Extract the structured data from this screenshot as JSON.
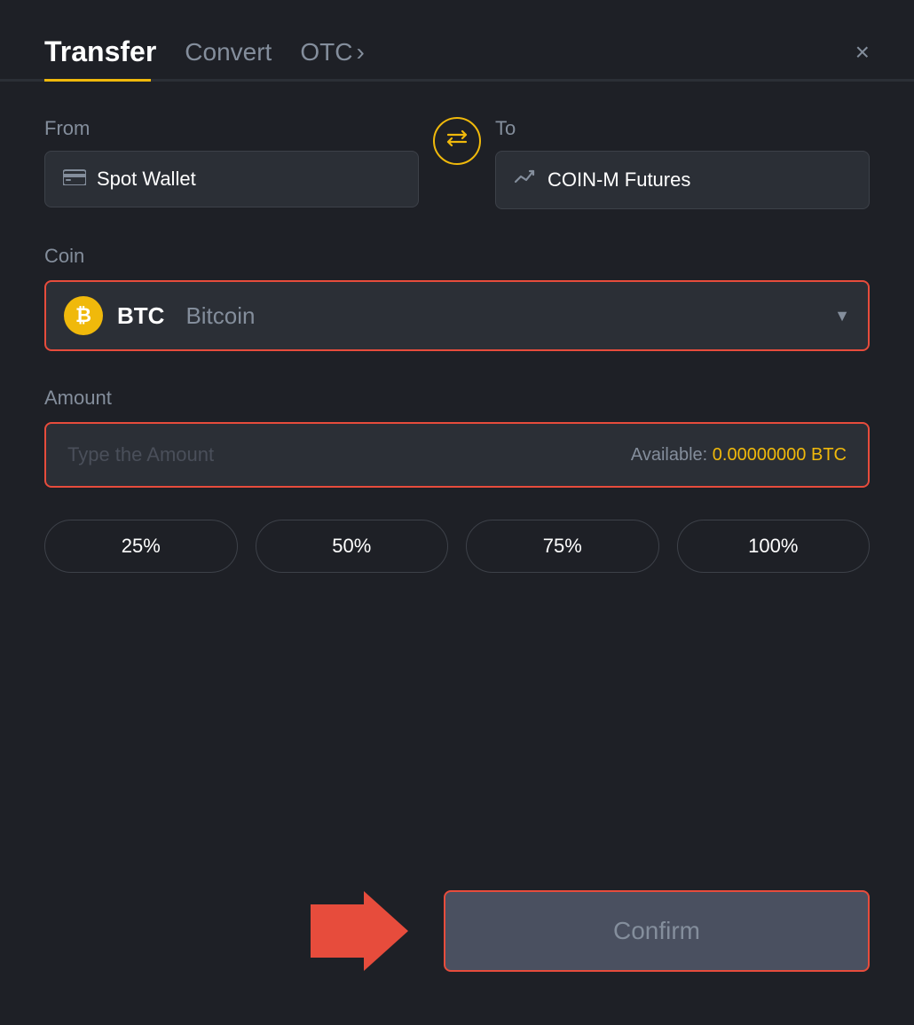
{
  "header": {
    "tab_transfer": "Transfer",
    "tab_convert": "Convert",
    "tab_otc": "OTC",
    "otc_chevron": "›",
    "close_label": "×"
  },
  "from": {
    "label": "From",
    "wallet_icon": "▬",
    "wallet_name": "Spot Wallet"
  },
  "to": {
    "label": "To",
    "wallet_icon": "↑",
    "wallet_name": "COIN-M Futures"
  },
  "swap": {
    "icon": "⇄"
  },
  "coin": {
    "label": "Coin",
    "symbol": "BTC",
    "name": "Bitcoin",
    "chevron": "▼"
  },
  "amount": {
    "label": "Amount",
    "placeholder": "Type the Amount",
    "available_label": "Available:",
    "available_value": "0.00000000 BTC"
  },
  "percentages": [
    {
      "label": "25%"
    },
    {
      "label": "50%"
    },
    {
      "label": "75%"
    },
    {
      "label": "100%"
    }
  ],
  "confirm": {
    "label": "Confirm"
  },
  "colors": {
    "accent": "#f0b90b",
    "red": "#e74c3c",
    "bg": "#1e2026",
    "surface": "#2b2f36"
  }
}
